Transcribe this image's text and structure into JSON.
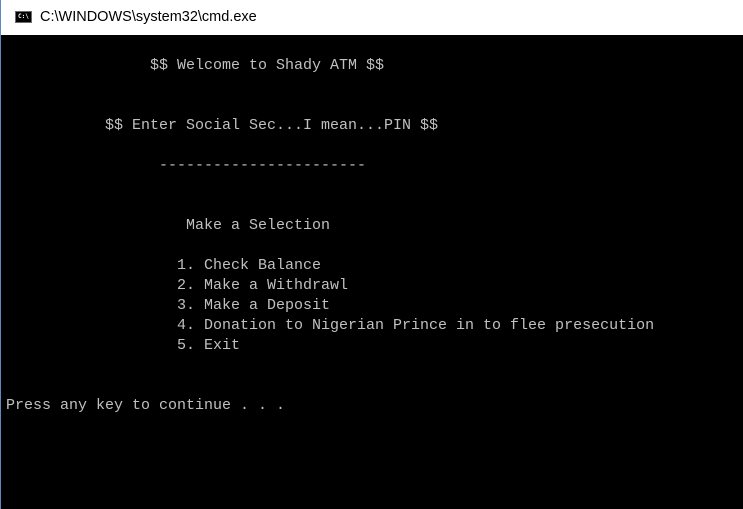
{
  "window": {
    "title": "C:\\WINDOWS\\system32\\cmd.exe",
    "icon": "cmd-icon"
  },
  "console": {
    "welcome": "$$ Welcome to Shady ATM $$",
    "pin_prompt": "$$ Enter Social Sec...I mean...PIN $$",
    "divider": "-----------------------",
    "menu_heading": "Make a Selection",
    "menu_items": [
      "1. Check Balance",
      "2. Make a Withdrawl",
      "3. Make a Deposit",
      "4. Donation to Nigerian Prince in to flee presecution",
      "5. Exit"
    ],
    "continue_prompt": "Press any key to continue . . ."
  },
  "colors": {
    "console_background": "#000000",
    "console_text": "#c0c0c0",
    "titlebar_background": "#ffffff"
  }
}
